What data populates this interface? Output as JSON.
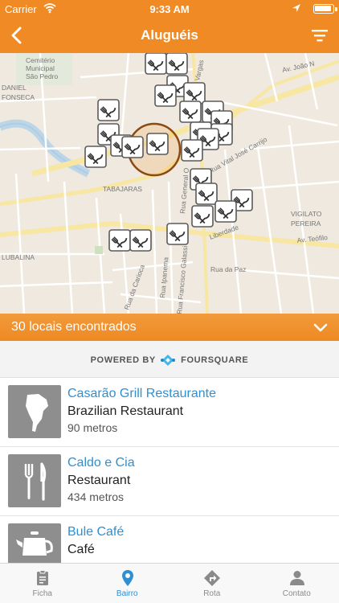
{
  "status_bar": {
    "carrier": "Carrier",
    "time": "9:33 AM"
  },
  "nav": {
    "title": "Aluguéis",
    "back_icon": "chevron-left-icon",
    "filter_icon": "filter-icon"
  },
  "map": {
    "labels": {
      "cemetery_1": "Cemitério",
      "cemetery_2": "Municipal",
      "cemetery_3": "São Pedro",
      "daniel": "DANIEL",
      "fonseca": "FONSECA",
      "tabajaras": "TABAJARAS",
      "vigilato": "VIGILATO",
      "pereira": "PEREIRA",
      "lubalina": "LUBALINA",
      "av_joao": "Av. João N",
      "rua_da_paz": "Rua da Paz",
      "av_teofilo": "Av. Teófilo",
      "rua_vital": "Rua Vital José Carrijo",
      "rua_general": "Rua General O",
      "rua_francisco": "Rua Francisco Galassi",
      "rua_ipanema": "Rua Ipanema",
      "rua_carioca": "Rua da Carioca",
      "vargas": "Vargas",
      "liberdade": "Liberdade"
    },
    "accent": "#f08a24",
    "marker_icon": "fork-knife-icon"
  },
  "results": {
    "count_text": "30 locais encontrados",
    "expand_icon": "chevron-down-icon"
  },
  "powered": {
    "prefix": "POWERED BY",
    "brand": "FOURSQUARE"
  },
  "places": [
    {
      "name": "Casarão Grill Restaurante",
      "category": "Brazilian Restaurant",
      "distance": "90 metros",
      "icon": "south-america-icon"
    },
    {
      "name": "Caldo e Cia",
      "category": "Restaurant",
      "distance": "434 metros",
      "icon": "fork-knife-icon"
    },
    {
      "name": "Bule Café",
      "category": "Café",
      "distance": "",
      "icon": "teapot-icon"
    }
  ],
  "tabs": [
    {
      "label": "Ficha",
      "icon": "clipboard-icon",
      "active": false
    },
    {
      "label": "Bairro",
      "icon": "map-pin-icon",
      "active": true
    },
    {
      "label": "Rota",
      "icon": "directions-icon",
      "active": false
    },
    {
      "label": "Contato",
      "icon": "person-icon",
      "active": false
    }
  ],
  "colors": {
    "primary": "#f08a24",
    "link": "#2f8fd2",
    "tab_inactive": "#8a8a8a"
  }
}
